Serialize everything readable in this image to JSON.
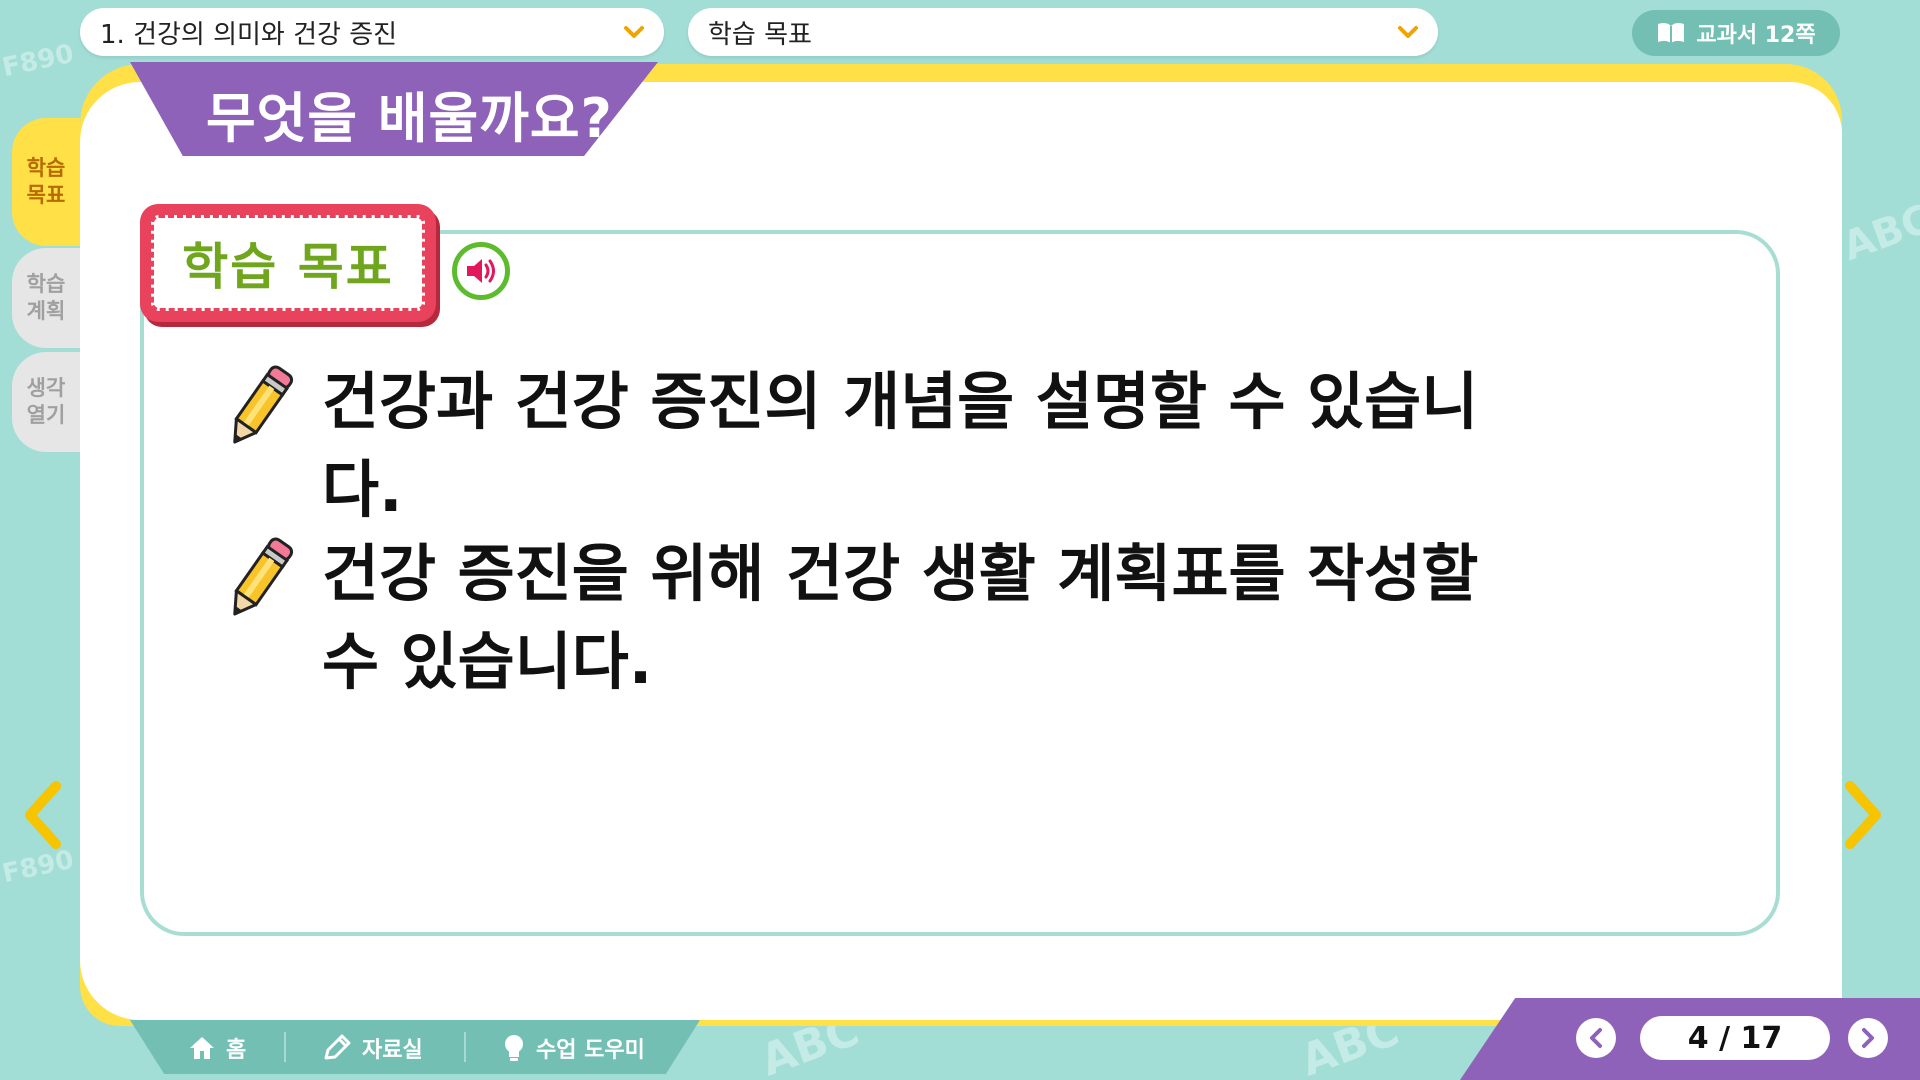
{
  "header": {
    "chapter_dropdown": "1. 건강의 의미와 건강 증진",
    "section_dropdown": "학습 목표",
    "textbook_label": "교과서 12쪽"
  },
  "title_tab": "무엇을 배울까요?",
  "side_tabs": [
    {
      "label_line1": "학습",
      "label_line2": "목표"
    },
    {
      "label_line1": "학습",
      "label_line2": "계획"
    },
    {
      "label_line1": "생각",
      "label_line2": "열기"
    }
  ],
  "goal_badge": "학습 목표",
  "goals": [
    "건강과 건강 증진의 개념을 설명할 수 있습니다.",
    "건강 증진을 위해 건강 생활 계획표를 작성할 수 있습니다."
  ],
  "bottom_bar": {
    "home": "홈",
    "resources": "자료실",
    "helper": "수업 도우미"
  },
  "pagination": {
    "current": "4",
    "total": "17",
    "display": "4 / 17"
  },
  "colors": {
    "background": "#a2ddd6",
    "board_accent": "#ffe047",
    "title_purple": "#8e62b8",
    "badge_red": "#e8425c",
    "badge_text_green": "#6fa61d",
    "bar_teal": "#74bfb4"
  },
  "icons": [
    "chevron-down-icon",
    "book-icon",
    "speaker-icon",
    "pencil-icon",
    "home-icon",
    "edit-icon",
    "lightbulb-icon",
    "chevron-left-icon",
    "chevron-right-icon"
  ]
}
